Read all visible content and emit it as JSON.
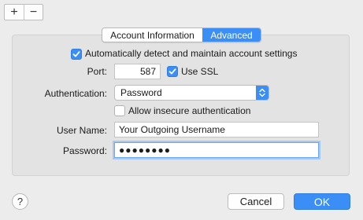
{
  "toolbar": {
    "add_label": "+",
    "remove_label": "−"
  },
  "tabs": [
    {
      "label": "Account Information",
      "selected": false
    },
    {
      "label": "Advanced",
      "selected": true
    }
  ],
  "auto_detect": {
    "label": "Automatically detect and maintain account settings",
    "checked": true
  },
  "port": {
    "label": "Port:",
    "value": "587"
  },
  "ssl": {
    "label": "Use SSL",
    "checked": true
  },
  "authentication": {
    "label": "Authentication:",
    "value": "Password"
  },
  "insecure_auth": {
    "label": "Allow insecure authentication",
    "checked": false
  },
  "username": {
    "label": "User Name:",
    "value": "Your Outgoing Username"
  },
  "password": {
    "label": "Password:",
    "value": "●●●●●●●●"
  },
  "help_label": "?",
  "buttons": {
    "cancel": "Cancel",
    "ok": "OK"
  },
  "colors": {
    "accent": "#3b8ef5",
    "panel": "#e3e3e3",
    "window": "#ececec"
  }
}
